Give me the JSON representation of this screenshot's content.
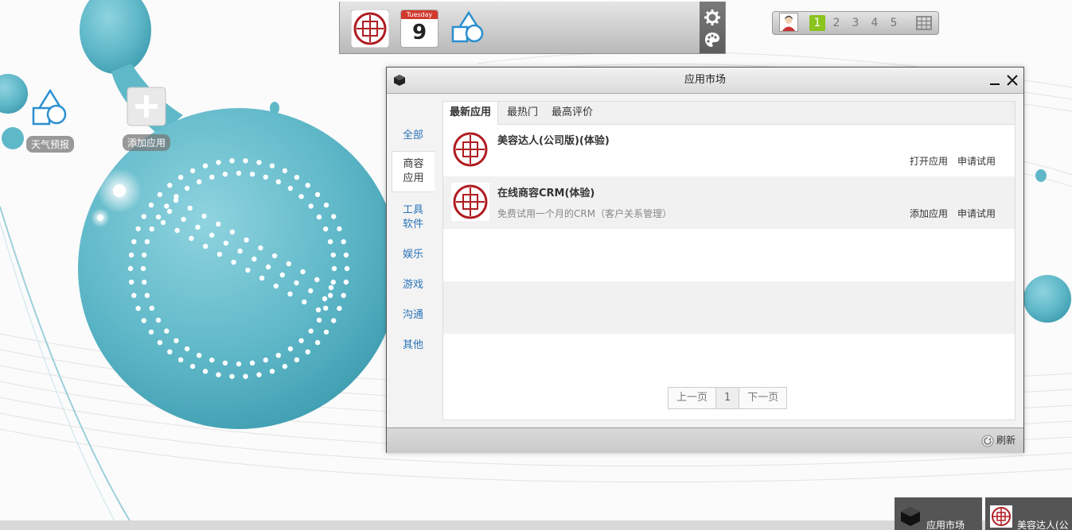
{
  "desktop": {
    "icons": [
      {
        "label": "天气预报",
        "icon": "shapes-icon"
      },
      {
        "label": "添加应用",
        "icon": "plus-icon"
      }
    ]
  },
  "dock": {
    "apps": [
      {
        "name": "zhongke-logo-icon"
      },
      {
        "name": "calendar-icon",
        "weekday": "Tuesday",
        "day": "9"
      },
      {
        "name": "shapes-icon"
      }
    ],
    "tools": [
      "gear-icon",
      "palette-icon"
    ]
  },
  "switcher": {
    "desktops": [
      "1",
      "2",
      "3",
      "4",
      "5"
    ],
    "active": "1"
  },
  "window": {
    "title": "应用市场",
    "nav": [
      "全部",
      "商容\n应用",
      "工具\n软件",
      "娱乐",
      "游戏",
      "沟通",
      "其他"
    ],
    "tabs": [
      "最新应用",
      "最热门",
      "最高评价"
    ],
    "apps": [
      {
        "name": "美容达人(公司版)(体验)",
        "desc": "",
        "actions": [
          "打开应用",
          "申请试用"
        ]
      },
      {
        "name": "在线商容CRM(体验)",
        "desc": "免费试用一个月的CRM（客户关系管理）",
        "actions": [
          "添加应用",
          "申请试用"
        ]
      }
    ],
    "pager": {
      "prev": "上一页",
      "current": "1",
      "next": "下一页"
    },
    "refresh": "刷新"
  },
  "taskbar": {
    "items": [
      "应用市场",
      "美容达人(公"
    ]
  },
  "colors": {
    "accent": "#5fb8c8",
    "link": "#2a73b9",
    "active_green": "#8bc31f"
  }
}
